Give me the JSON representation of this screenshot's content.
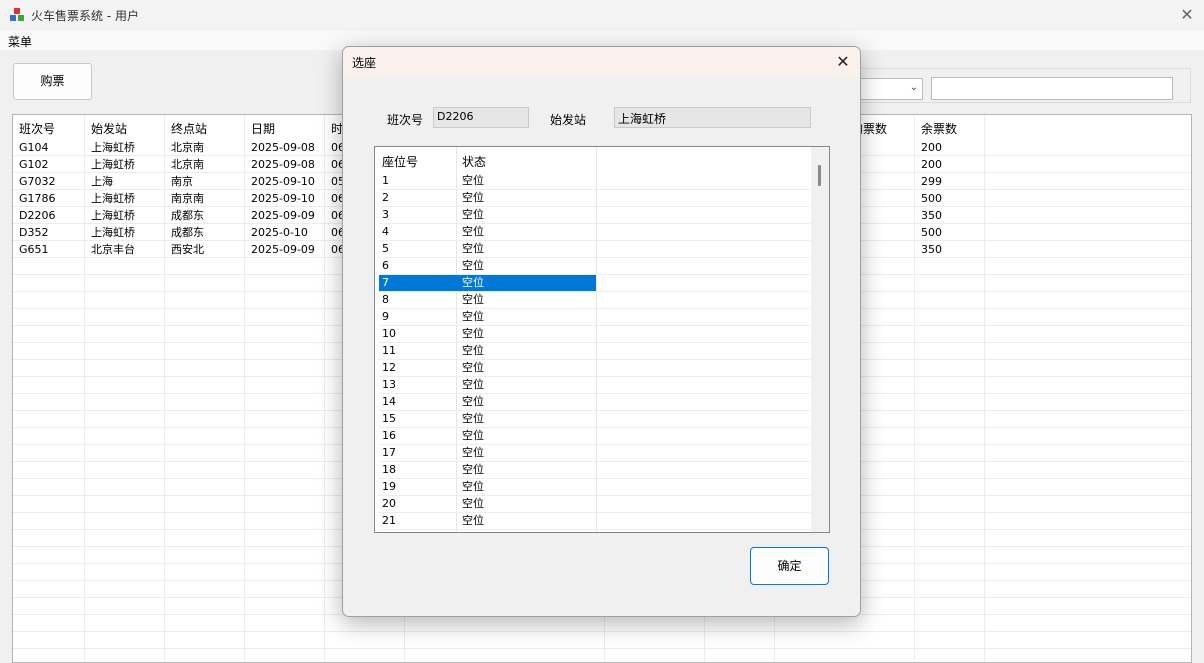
{
  "window": {
    "title": "火车售票系统 - 用户",
    "icon": "app-cubes-icon",
    "close_glyph": "✕"
  },
  "menu": {
    "label": "菜单"
  },
  "toolbar": {
    "buy_label": "购票",
    "search_value": ""
  },
  "grid": {
    "columns": [
      "班次号",
      "始发站",
      "终点站",
      "日期",
      "时",
      "购票数",
      "余票数"
    ],
    "rows": [
      [
        "G104",
        "上海虹桥",
        "北京南",
        "2025-09-08",
        "06",
        "",
        "200"
      ],
      [
        "G102",
        "上海虹桥",
        "北京南",
        "2025-09-08",
        "06",
        "",
        "200"
      ],
      [
        "G7032",
        "上海",
        "南京",
        "2025-09-10",
        "05",
        "",
        "299"
      ],
      [
        "G1786",
        "上海虹桥",
        "南京南",
        "2025-09-10",
        "06",
        "",
        "500"
      ],
      [
        "D2206",
        "上海虹桥",
        "成都东",
        "2025-09-09",
        "06",
        "",
        "350"
      ],
      [
        "D352",
        "上海虹桥",
        "成都东",
        "2025-0-10",
        "06",
        "",
        "500"
      ],
      [
        "G651",
        "北京丰台",
        "西安北",
        "2025-09-09",
        "06",
        "",
        "350"
      ]
    ]
  },
  "dialog": {
    "title": "选座",
    "close_glyph": "✕",
    "train_label": "班次号",
    "train_value": "D2206",
    "station_label": "始发站",
    "station_value": "上海虹桥",
    "list_headers": [
      "座位号",
      "状态"
    ],
    "selected_seat": "7",
    "seats": [
      [
        "1",
        "空位"
      ],
      [
        "2",
        "空位"
      ],
      [
        "3",
        "空位"
      ],
      [
        "4",
        "空位"
      ],
      [
        "5",
        "空位"
      ],
      [
        "6",
        "空位"
      ],
      [
        "7",
        "空位"
      ],
      [
        "8",
        "空位"
      ],
      [
        "9",
        "空位"
      ],
      [
        "10",
        "空位"
      ],
      [
        "11",
        "空位"
      ],
      [
        "12",
        "空位"
      ],
      [
        "13",
        "空位"
      ],
      [
        "14",
        "空位"
      ],
      [
        "15",
        "空位"
      ],
      [
        "16",
        "空位"
      ],
      [
        "17",
        "空位"
      ],
      [
        "18",
        "空位"
      ],
      [
        "19",
        "空位"
      ],
      [
        "20",
        "空位"
      ],
      [
        "21",
        "空位"
      ]
    ],
    "ok_label": "确定"
  },
  "colors": {
    "selection": "#0078d7",
    "accent_border": "#0078d7"
  }
}
